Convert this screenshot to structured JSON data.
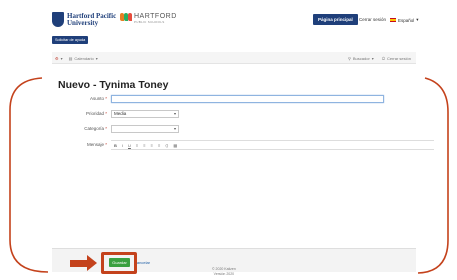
{
  "header": {
    "logo_hpu": {
      "line1": "Hartford Pacific",
      "line2": "University"
    },
    "logo_hf": {
      "title": "HARTFORD",
      "subtitle": "PUBLIC SCHOOLS"
    },
    "start_button": "Página principal",
    "logout": "Cerrar sesión",
    "language": "Español",
    "help_button": "Solicitar de ayuda"
  },
  "toolbar": {
    "left_items": [
      "Calendario"
    ],
    "right_items": [
      "Buscador",
      "Cerrar sesión"
    ]
  },
  "form": {
    "title": "Nuevo - Tynima Toney",
    "fields": {
      "subject": {
        "label": "Asunto",
        "value": ""
      },
      "priority": {
        "label": "Prioridad",
        "value": "Media"
      },
      "category": {
        "label": "Categoría",
        "value": ""
      },
      "message": {
        "label": "Mensaje"
      }
    },
    "editor_tools": [
      "B",
      "I",
      "U",
      "≡",
      "≡",
      "≡",
      "≡",
      "⟨⟩",
      "▦"
    ]
  },
  "footer": {
    "save_label": "Guardar",
    "cancel_label": "Cancelar",
    "copyright_line1": "© 2020 Kaiizen",
    "copyright_line2": "Versión 2020"
  },
  "colors": {
    "brand": "#1f3f7a",
    "save": "#3aa040",
    "annotation": "#c4421c"
  }
}
